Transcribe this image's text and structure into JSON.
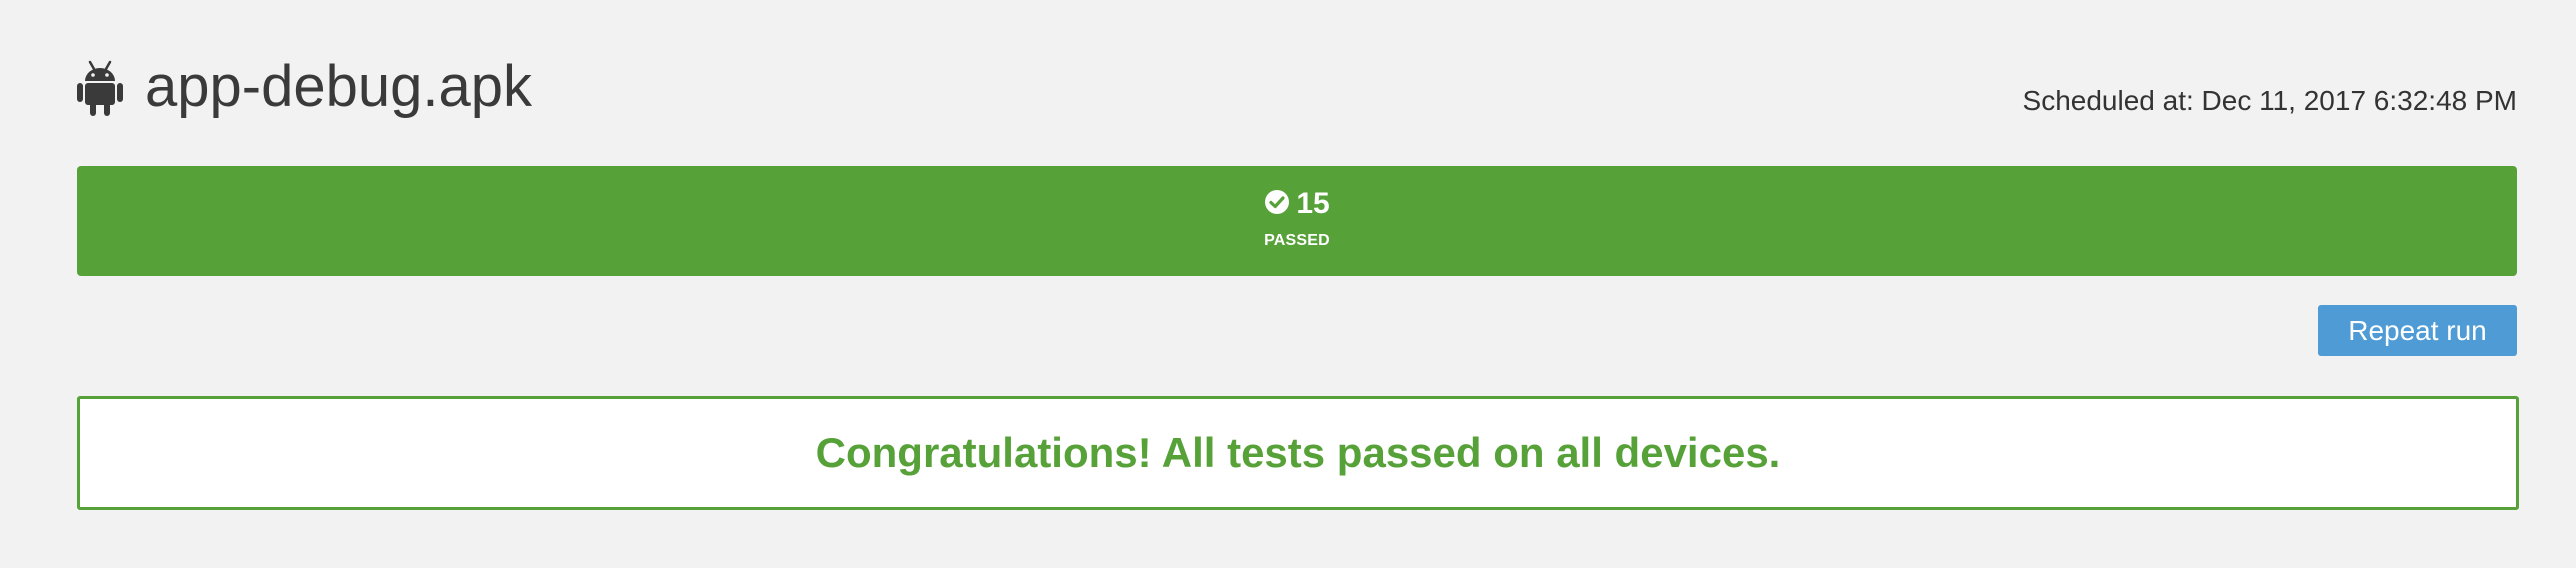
{
  "header": {
    "app_icon": "android-icon",
    "title": "app-debug.apk",
    "scheduled": "Scheduled at: Dec 11, 2017 6:32:48 PM"
  },
  "status": {
    "icon": "check-circle-icon",
    "count": "15",
    "label": "PASSED",
    "color": "#57a139"
  },
  "actions": {
    "repeat_label": "Repeat run",
    "button_color": "#4f9bd6"
  },
  "result": {
    "message": "Congratulations! All tests passed on all devices."
  }
}
